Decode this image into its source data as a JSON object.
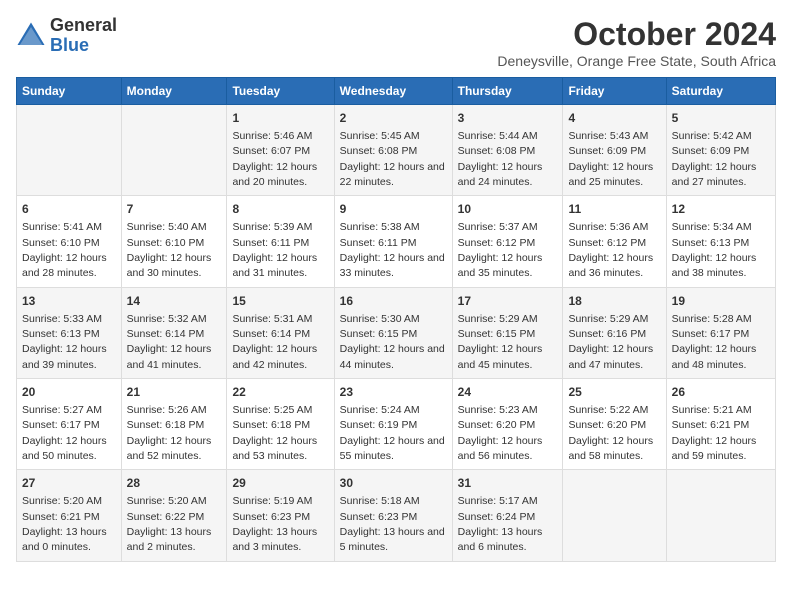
{
  "header": {
    "logo_general": "General",
    "logo_blue": "Blue",
    "month_title": "October 2024",
    "location": "Deneysville, Orange Free State, South Africa"
  },
  "weekdays": [
    "Sunday",
    "Monday",
    "Tuesday",
    "Wednesday",
    "Thursday",
    "Friday",
    "Saturday"
  ],
  "rows": [
    [
      {
        "day": "",
        "info": ""
      },
      {
        "day": "",
        "info": ""
      },
      {
        "day": "1",
        "info": "Sunrise: 5:46 AM\nSunset: 6:07 PM\nDaylight: 12 hours and 20 minutes."
      },
      {
        "day": "2",
        "info": "Sunrise: 5:45 AM\nSunset: 6:08 PM\nDaylight: 12 hours and 22 minutes."
      },
      {
        "day": "3",
        "info": "Sunrise: 5:44 AM\nSunset: 6:08 PM\nDaylight: 12 hours and 24 minutes."
      },
      {
        "day": "4",
        "info": "Sunrise: 5:43 AM\nSunset: 6:09 PM\nDaylight: 12 hours and 25 minutes."
      },
      {
        "day": "5",
        "info": "Sunrise: 5:42 AM\nSunset: 6:09 PM\nDaylight: 12 hours and 27 minutes."
      }
    ],
    [
      {
        "day": "6",
        "info": "Sunrise: 5:41 AM\nSunset: 6:10 PM\nDaylight: 12 hours and 28 minutes."
      },
      {
        "day": "7",
        "info": "Sunrise: 5:40 AM\nSunset: 6:10 PM\nDaylight: 12 hours and 30 minutes."
      },
      {
        "day": "8",
        "info": "Sunrise: 5:39 AM\nSunset: 6:11 PM\nDaylight: 12 hours and 31 minutes."
      },
      {
        "day": "9",
        "info": "Sunrise: 5:38 AM\nSunset: 6:11 PM\nDaylight: 12 hours and 33 minutes."
      },
      {
        "day": "10",
        "info": "Sunrise: 5:37 AM\nSunset: 6:12 PM\nDaylight: 12 hours and 35 minutes."
      },
      {
        "day": "11",
        "info": "Sunrise: 5:36 AM\nSunset: 6:12 PM\nDaylight: 12 hours and 36 minutes."
      },
      {
        "day": "12",
        "info": "Sunrise: 5:34 AM\nSunset: 6:13 PM\nDaylight: 12 hours and 38 minutes."
      }
    ],
    [
      {
        "day": "13",
        "info": "Sunrise: 5:33 AM\nSunset: 6:13 PM\nDaylight: 12 hours and 39 minutes."
      },
      {
        "day": "14",
        "info": "Sunrise: 5:32 AM\nSunset: 6:14 PM\nDaylight: 12 hours and 41 minutes."
      },
      {
        "day": "15",
        "info": "Sunrise: 5:31 AM\nSunset: 6:14 PM\nDaylight: 12 hours and 42 minutes."
      },
      {
        "day": "16",
        "info": "Sunrise: 5:30 AM\nSunset: 6:15 PM\nDaylight: 12 hours and 44 minutes."
      },
      {
        "day": "17",
        "info": "Sunrise: 5:29 AM\nSunset: 6:15 PM\nDaylight: 12 hours and 45 minutes."
      },
      {
        "day": "18",
        "info": "Sunrise: 5:29 AM\nSunset: 6:16 PM\nDaylight: 12 hours and 47 minutes."
      },
      {
        "day": "19",
        "info": "Sunrise: 5:28 AM\nSunset: 6:17 PM\nDaylight: 12 hours and 48 minutes."
      }
    ],
    [
      {
        "day": "20",
        "info": "Sunrise: 5:27 AM\nSunset: 6:17 PM\nDaylight: 12 hours and 50 minutes."
      },
      {
        "day": "21",
        "info": "Sunrise: 5:26 AM\nSunset: 6:18 PM\nDaylight: 12 hours and 52 minutes."
      },
      {
        "day": "22",
        "info": "Sunrise: 5:25 AM\nSunset: 6:18 PM\nDaylight: 12 hours and 53 minutes."
      },
      {
        "day": "23",
        "info": "Sunrise: 5:24 AM\nSunset: 6:19 PM\nDaylight: 12 hours and 55 minutes."
      },
      {
        "day": "24",
        "info": "Sunrise: 5:23 AM\nSunset: 6:20 PM\nDaylight: 12 hours and 56 minutes."
      },
      {
        "day": "25",
        "info": "Sunrise: 5:22 AM\nSunset: 6:20 PM\nDaylight: 12 hours and 58 minutes."
      },
      {
        "day": "26",
        "info": "Sunrise: 5:21 AM\nSunset: 6:21 PM\nDaylight: 12 hours and 59 minutes."
      }
    ],
    [
      {
        "day": "27",
        "info": "Sunrise: 5:20 AM\nSunset: 6:21 PM\nDaylight: 13 hours and 0 minutes."
      },
      {
        "day": "28",
        "info": "Sunrise: 5:20 AM\nSunset: 6:22 PM\nDaylight: 13 hours and 2 minutes."
      },
      {
        "day": "29",
        "info": "Sunrise: 5:19 AM\nSunset: 6:23 PM\nDaylight: 13 hours and 3 minutes."
      },
      {
        "day": "30",
        "info": "Sunrise: 5:18 AM\nSunset: 6:23 PM\nDaylight: 13 hours and 5 minutes."
      },
      {
        "day": "31",
        "info": "Sunrise: 5:17 AM\nSunset: 6:24 PM\nDaylight: 13 hours and 6 minutes."
      },
      {
        "day": "",
        "info": ""
      },
      {
        "day": "",
        "info": ""
      }
    ]
  ]
}
